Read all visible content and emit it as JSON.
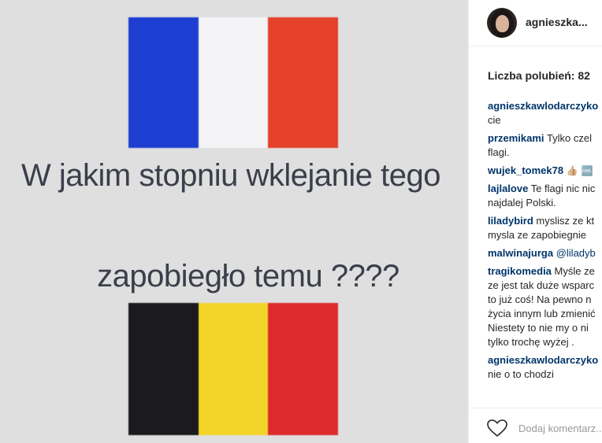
{
  "image": {
    "caption_line1": "W jakim stopniu wklejanie tego",
    "caption_line2": "zapobiegło temu ????",
    "flag_top_colors": [
      "#1d3fd1",
      "#f4f4f6",
      "#e4402a"
    ],
    "flag_bottom_colors": [
      "#1b1a1c",
      "#f3d52a",
      "#df2a2c"
    ],
    "caption_color": "#3b3f4a"
  },
  "header": {
    "username": "agnieszka..."
  },
  "likes_label": "Liczba polubień: 82",
  "comments": [
    {
      "user": "agnieszkawlodarczyko",
      "text": "cie"
    },
    {
      "user": "przemikami",
      "text": "Tylko czel flagi."
    },
    {
      "user": "wujek_tomek78",
      "text": "👍🏼 🆒"
    },
    {
      "user": "lajlalove",
      "text": "Te flagi nic nic najdalej Polski."
    },
    {
      "user": "liladybird",
      "text": "myslisz ze kt mysla ze zapobiegnie"
    },
    {
      "user": "malwinajurga",
      "text": "@liladyb"
    },
    {
      "user": "tragikomedia",
      "text": "Myśle ze ze jest tak duże wsparc to już coś! Na pewno n życia innym lub zmienić Niestety to nie my o ni tylko trochę wyżej ."
    },
    {
      "user": "agnieszkawlodarczyko",
      "text": "nie o to chodzi"
    }
  ],
  "footer": {
    "add_comment_placeholder": "Dodaj komentarz..."
  },
  "colors": {
    "username": "#262626",
    "comment_user": "#003569",
    "placeholder": "#999999"
  }
}
